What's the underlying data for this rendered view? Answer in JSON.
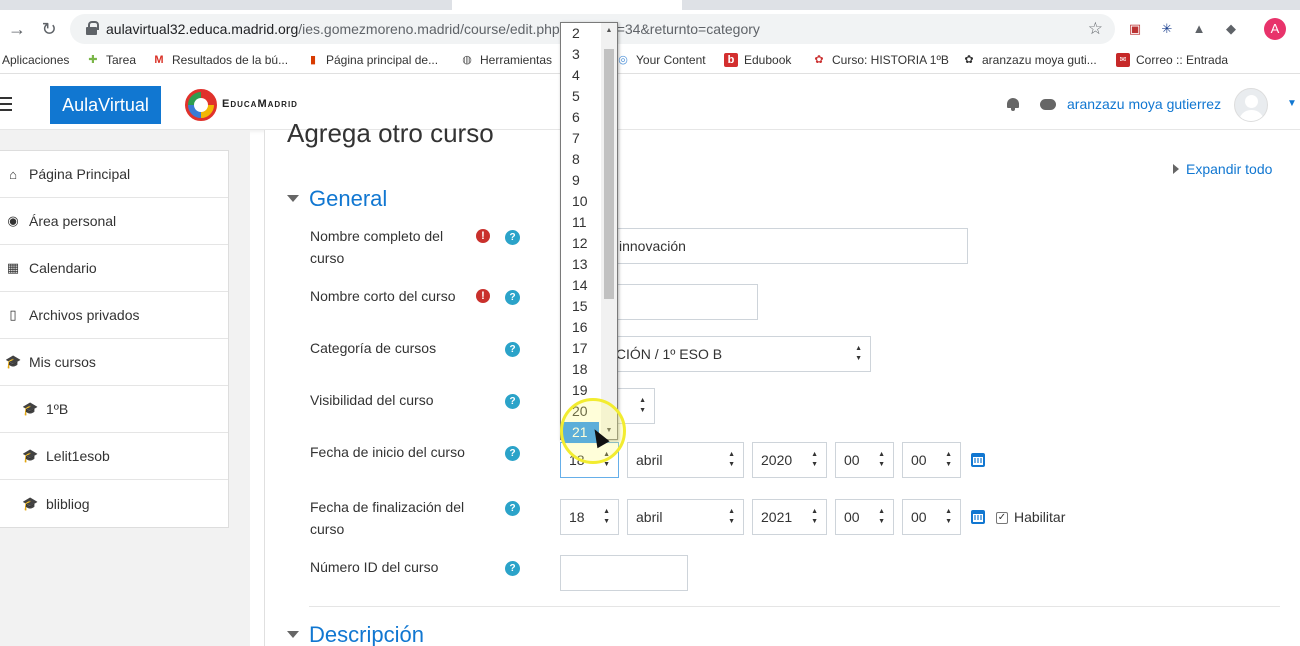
{
  "browser": {
    "url_host": "aulavirtual32.educa.madrid.org",
    "url_path": "/ies.gomezmoreno.madrid/course/edit.php",
    "url_tail": "y=34&returnto=category",
    "profile_initial": "A"
  },
  "bookmarks": [
    {
      "label": "Aplicaciones",
      "icon": "apps-icon"
    },
    {
      "label": "Tarea",
      "icon": "tarea-icon"
    },
    {
      "label": "Resultados de la bú...",
      "icon": "gmail-icon"
    },
    {
      "label": "Página principal de...",
      "icon": "office-icon"
    },
    {
      "label": "Herramientas",
      "icon": "globe-icon"
    },
    {
      "label": "Your Content",
      "icon": "content-icon"
    },
    {
      "label": "Edubook",
      "icon": "edubook-icon"
    },
    {
      "label": "Curso: HISTORIA 1ºB",
      "icon": "moodle-icon"
    },
    {
      "label": "aranzazu moya guti...",
      "icon": "moodle-icon"
    },
    {
      "label": "Correo :: Entrada",
      "icon": "mail-icon"
    }
  ],
  "header": {
    "brand": "AulaVirtual",
    "logo_text": "EducaMadrid",
    "user_name": "aranzazu moya gutierrez"
  },
  "sidebar": {
    "items": [
      {
        "label": "Página Principal",
        "icon": "home-icon",
        "glyph": "⌂"
      },
      {
        "label": "Área personal",
        "icon": "dashboard-icon",
        "glyph": "◉"
      },
      {
        "label": "Calendario",
        "icon": "calendar-icon",
        "glyph": "▦"
      },
      {
        "label": "Archivos privados",
        "icon": "file-icon",
        "glyph": "▯"
      },
      {
        "label": "Mis cursos",
        "icon": "graduation-cap-icon",
        "glyph": "🎓"
      },
      {
        "label": "1ºB",
        "icon": "graduation-cap-icon",
        "glyph": "🎓"
      },
      {
        "label": "Lelit1esob",
        "icon": "graduation-cap-icon",
        "glyph": "🎓"
      },
      {
        "label": "blibliog",
        "icon": "graduation-cap-icon",
        "glyph": "🎓"
      }
    ]
  },
  "main": {
    "page_title": "Agrega otro curso",
    "expand_all": "Expandir todo",
    "section_general": "General",
    "section_descripcion": "Descripción",
    "fields": {
      "fullname_label": "Nombre completo del curso",
      "fullname_value": "innovación",
      "shortname_label": "Nombre corto del curso",
      "category_label": "Categoría de cursos",
      "category_value": "TACIÓN / 1º ESO B",
      "visibility_label": "Visibilidad del curso",
      "visibility_value": "r",
      "startdate_label": "Fecha de inicio del curso",
      "start_day": "18",
      "start_month": "abril",
      "start_year": "2020",
      "start_hour": "00",
      "start_minute": "00",
      "enddate_label": "Fecha de finalización del curso",
      "end_day": "18",
      "end_month": "abril",
      "end_year": "2021",
      "end_hour": "00",
      "end_minute": "00",
      "enable_label": "Habilitar",
      "idnumber_label": "Número ID del curso"
    }
  },
  "day_dropdown": {
    "options": [
      "2",
      "3",
      "4",
      "5",
      "6",
      "7",
      "8",
      "9",
      "10",
      "11",
      "12",
      "13",
      "14",
      "15",
      "16",
      "17",
      "18",
      "19",
      "20",
      "21"
    ],
    "selected": "21"
  },
  "colors": {
    "accent": "#1177d1",
    "required": "#c9302c",
    "help": "#2ba3c9",
    "selection": "#1e90ff"
  }
}
